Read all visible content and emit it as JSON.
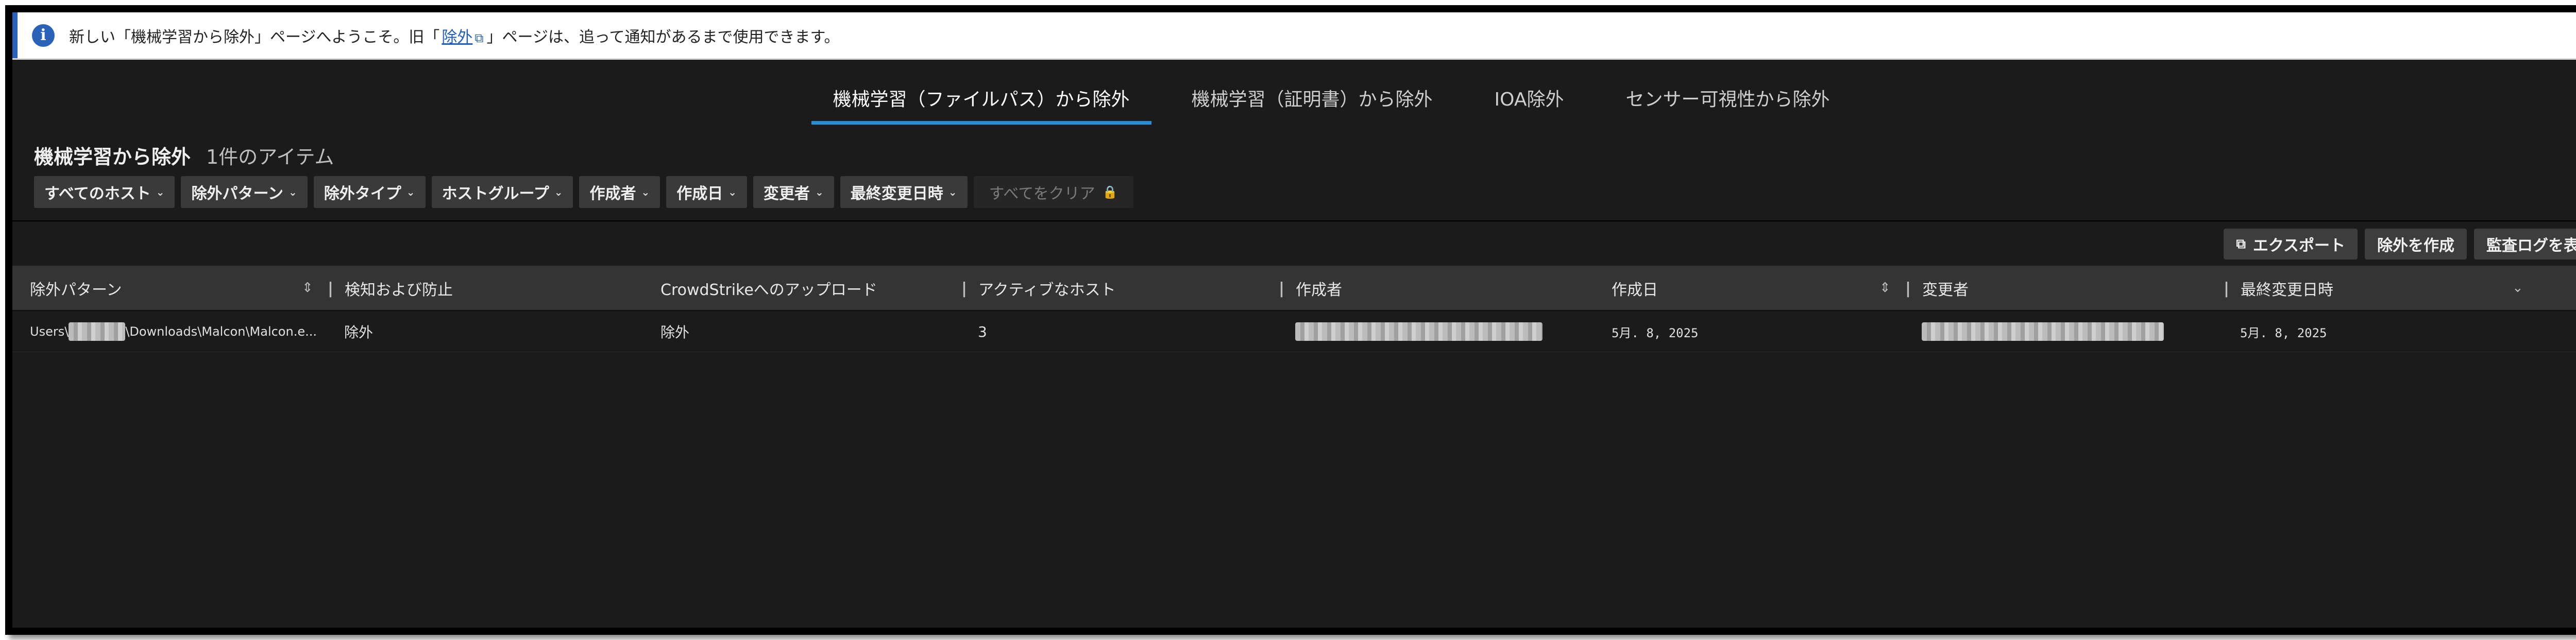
{
  "banner": {
    "text_before": "新しい「機械学習から除外」ページへようこそ。旧「",
    "link": "除外",
    "text_after": "」ページは、追って通知があるまで使用できます。"
  },
  "tabs": [
    {
      "label": "機械学習（ファイルパス）から除外",
      "active": true
    },
    {
      "label": "機械学習（証明書）から除外",
      "active": false
    },
    {
      "label": "IOA除外",
      "active": false
    },
    {
      "label": "センサー可視性から除外",
      "active": false
    }
  ],
  "page": {
    "title": "機械学習から除外",
    "count": "1件のアイテム"
  },
  "filters": [
    "すべてのホスト",
    "除外パターン",
    "除外タイプ",
    "ホストグループ",
    "作成者",
    "作成日",
    "変更者",
    "最終変更日時"
  ],
  "clear_all": "すべてをクリア",
  "toolbar": {
    "export": "エクスポート",
    "create": "除外を作成",
    "audit": "監査ログを表示"
  },
  "table": {
    "columns": [
      "除外パターン",
      "検知および防止",
      "CrowdStrikeへのアップロード",
      "アクティブなホスト",
      "作成者",
      "作成日",
      "変更者",
      "最終変更日時"
    ],
    "rows": [
      {
        "pattern_prefix": "Users\\",
        "pattern_suffix": "\\Downloads\\Malcon\\Malcon.e...",
        "detection": "除外",
        "upload": "除外",
        "hosts": "3",
        "created": "5月. 8, 2025",
        "modified_at": "5月. 8, 2025"
      }
    ]
  }
}
